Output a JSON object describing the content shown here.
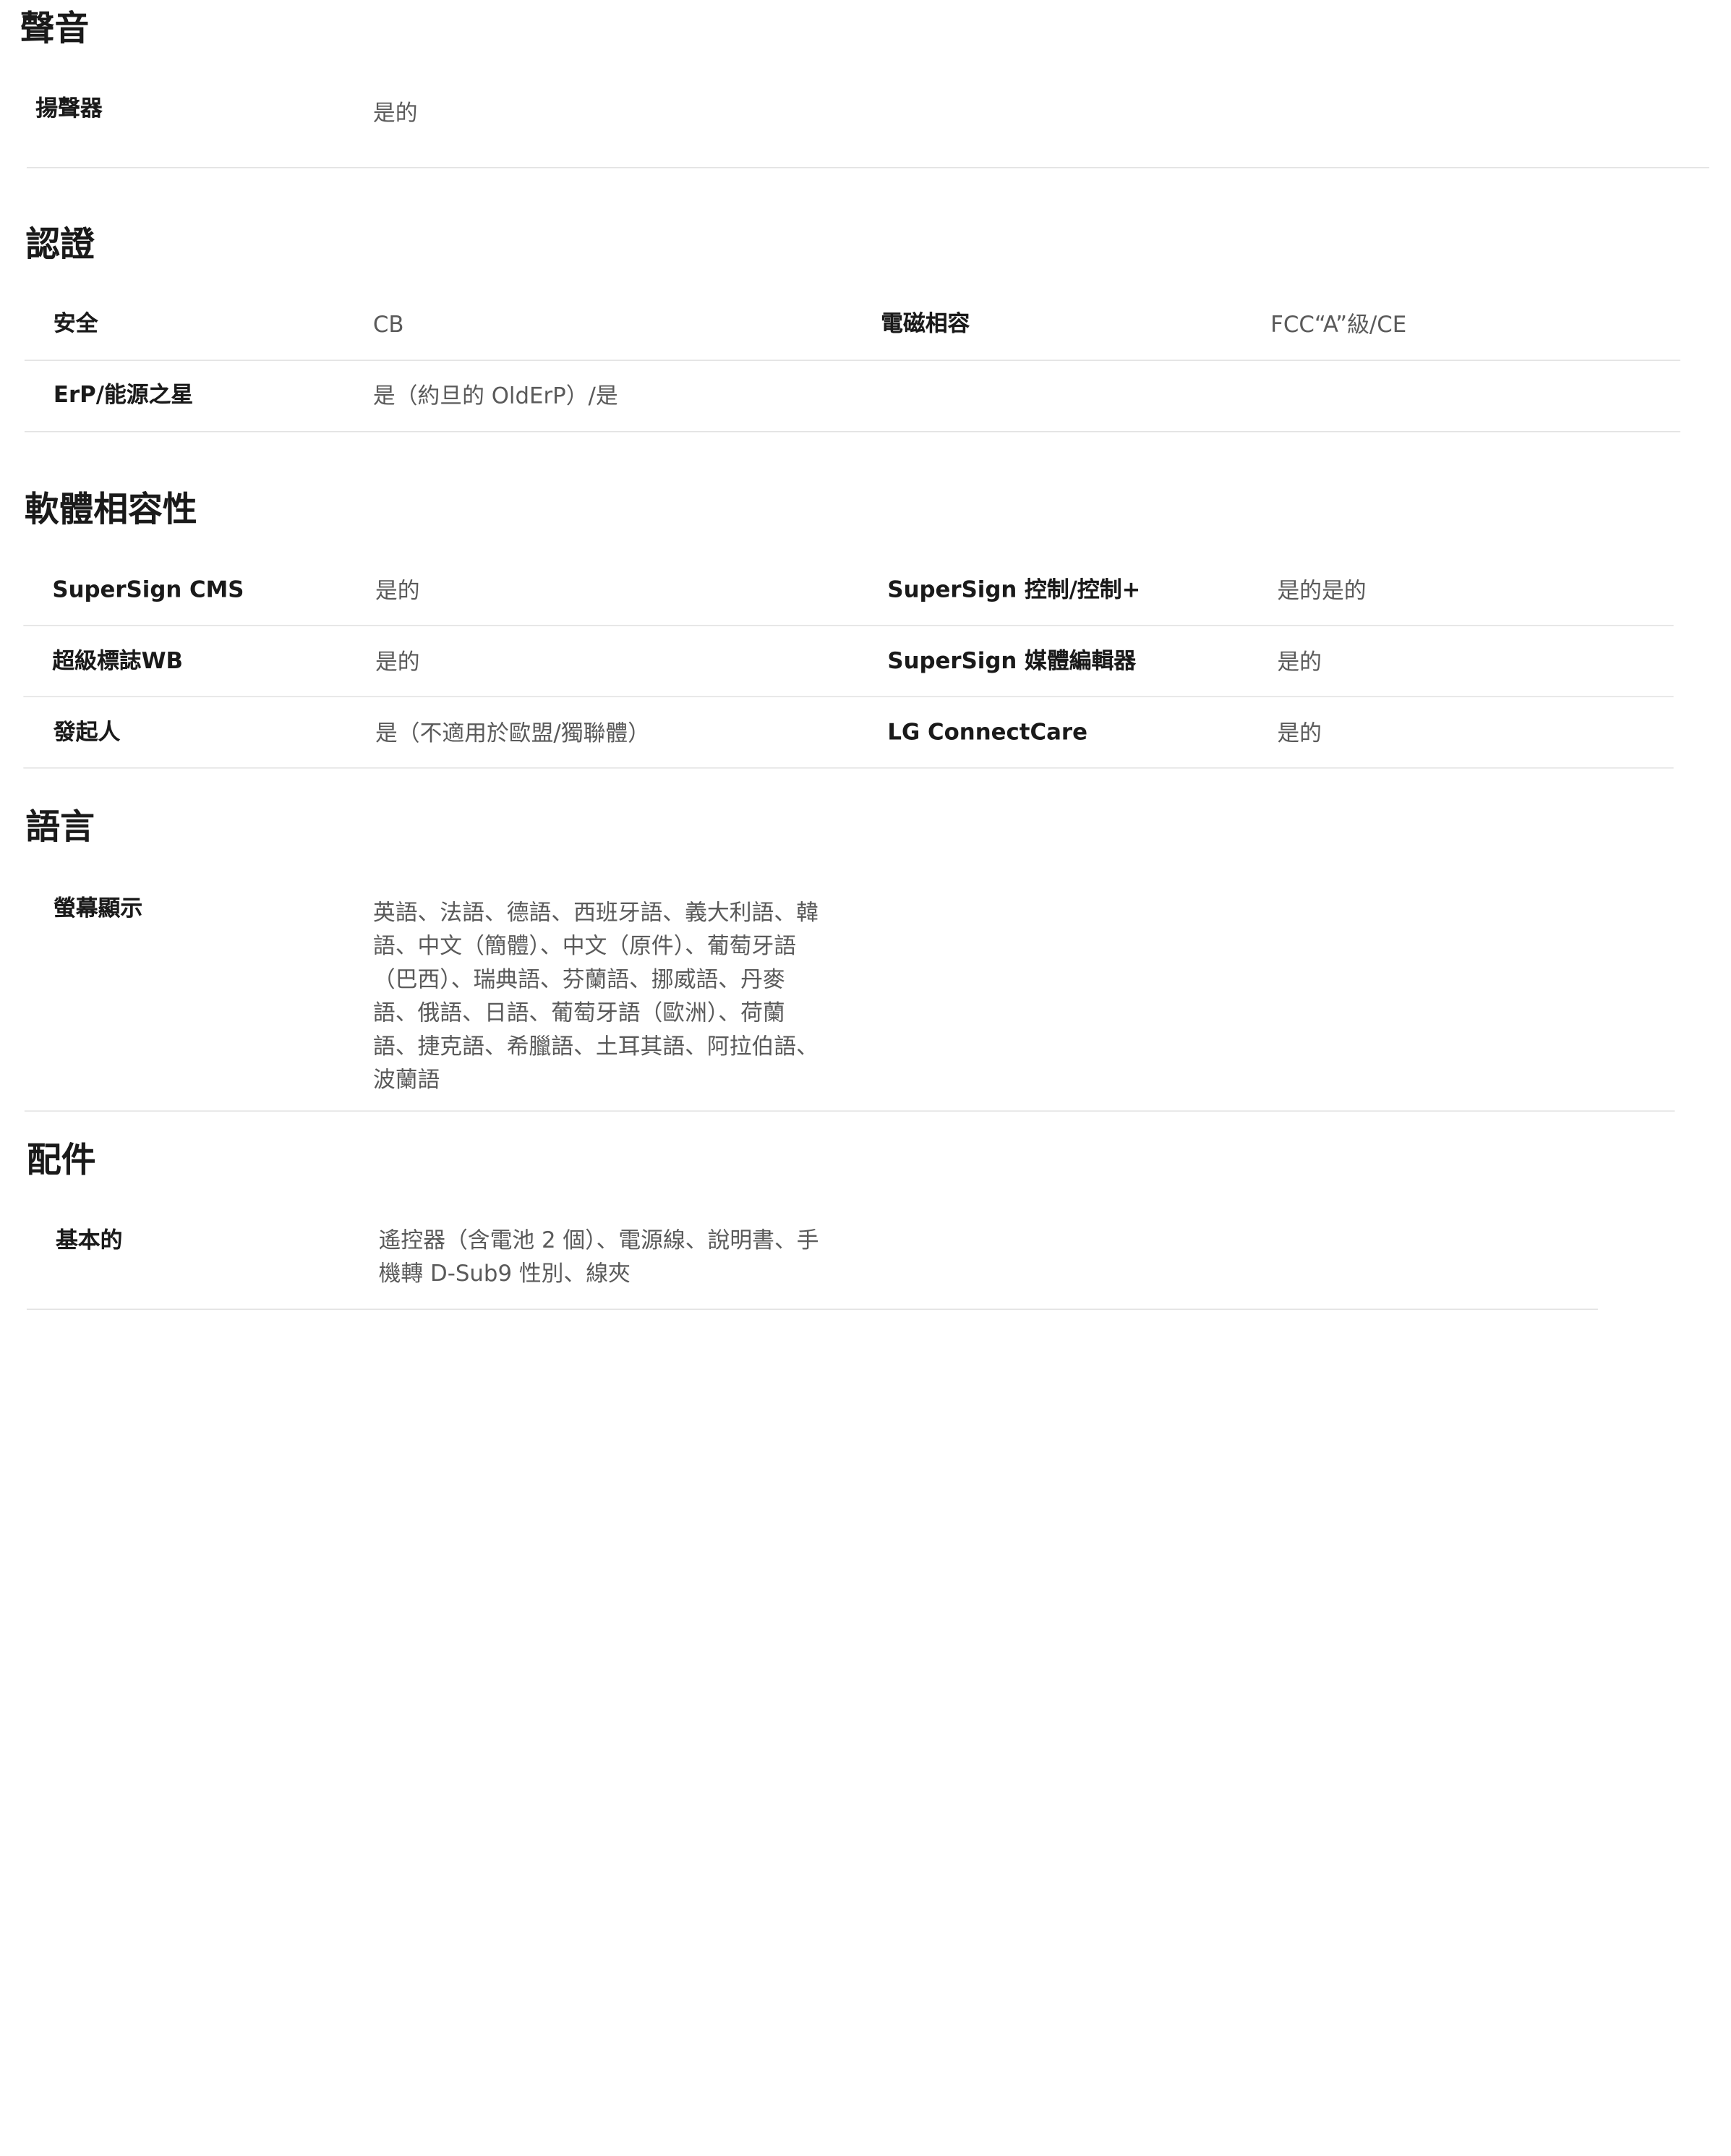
{
  "sound": {
    "title": "聲音",
    "rows": [
      {
        "label": "揚聲器",
        "value": "是的"
      }
    ]
  },
  "certification": {
    "title": "認證",
    "rows": [
      {
        "label": "安全",
        "value": "CB",
        "label2": "電磁相容",
        "value2": "FCC“A”級/CE"
      },
      {
        "label": "ErP/能源之星",
        "value": "是（約旦的 OldErP）/是"
      }
    ]
  },
  "software": {
    "title": "軟體相容性",
    "rows": [
      {
        "label": "SuperSign CMS",
        "value": "是的",
        "label2": "SuperSign 控制/控制+",
        "value2": "是的是的"
      },
      {
        "label": "超級標誌WB",
        "value": "是的",
        "label2": "SuperSign 媒體編輯器",
        "value2": "是的"
      },
      {
        "label": "發起人",
        "value": "是（不適用於歐盟/獨聯體）",
        "label2": "LG ConnectCare",
        "value2": "是的"
      }
    ]
  },
  "language": {
    "title": "語言",
    "rows": [
      {
        "label": "螢幕顯示",
        "value": "英語、法語、德語、西班牙語、義大利語、韓語、中文（簡體）、中文（原件）、葡萄牙語（巴西）、瑞典語、芬蘭語、挪威語、丹麥語、俄語、日語、葡萄牙語（歐洲）、荷蘭語、捷克語、希臘語、土耳其語、阿拉伯語、波蘭語"
      }
    ]
  },
  "accessories": {
    "title": "配件",
    "rows": [
      {
        "label": "基本的",
        "value": "遙控器（含電池 2 個）、電源線、說明書、手機轉 D-Sub9 性別、線夾"
      }
    ]
  }
}
